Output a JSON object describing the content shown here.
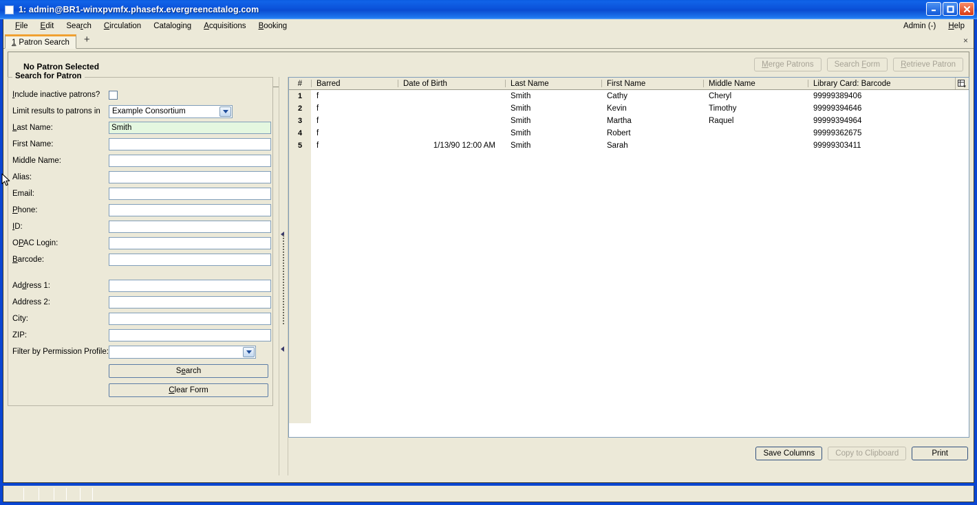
{
  "window": {
    "title": "1: admin@BR1-winxpvmfx.phasefx.evergreencatalog.com",
    "minimize_label": "Minimize",
    "maximize_label": "Maximize",
    "close_label": "Close"
  },
  "menubar": {
    "items": [
      {
        "label": "File",
        "accel_index": 0
      },
      {
        "label": "Edit",
        "accel_index": 0
      },
      {
        "label": "Search",
        "accel_index": 3
      },
      {
        "label": "Circulation",
        "accel_index": 0
      },
      {
        "label": "Cataloging",
        "accel_index": 8
      },
      {
        "label": "Acquisitions",
        "accel_index": 0
      },
      {
        "label": "Booking",
        "accel_index": 0
      }
    ],
    "right": [
      {
        "label": "Admin (-)",
        "accel_index": -1
      },
      {
        "label": "Help",
        "accel_index": 0
      }
    ]
  },
  "tabs": {
    "items": [
      {
        "number": "1",
        "label": "Patron Search"
      }
    ],
    "add_label": "+",
    "close_label": "×"
  },
  "patron_header": {
    "status_label": "No Patron Selected",
    "buttons": [
      {
        "label": "Merge Patrons",
        "accel_index": 0,
        "disabled": true
      },
      {
        "label": "Search Form",
        "accel_index": 7,
        "disabled": true
      },
      {
        "label": "Retrieve Patron",
        "accel_index": 0,
        "disabled": true
      }
    ]
  },
  "search_form": {
    "legend": "Search for Patron",
    "include_inactive": {
      "label": "Include inactive patrons?",
      "accel_index": 0,
      "checked": false
    },
    "limit_results": {
      "label": "Limit results to patrons in",
      "accel_index": -1,
      "value": "Example Consortium",
      "options": [
        "Example Consortium"
      ]
    },
    "fields": [
      {
        "label": "Last Name:",
        "accel_index": 0,
        "value": "Smith",
        "placeholder": "",
        "focused": true
      },
      {
        "label": "First Name:",
        "accel_index": -1,
        "value": "",
        "placeholder": "",
        "focused": false
      },
      {
        "label": "Middle Name:",
        "accel_index": -1,
        "value": "",
        "placeholder": "",
        "focused": false
      },
      {
        "label": "Alias:",
        "accel_index": -1,
        "value": "",
        "placeholder": "",
        "focused": false
      },
      {
        "label": "Email:",
        "accel_index": -1,
        "value": "",
        "placeholder": "",
        "focused": false
      },
      {
        "label": "Phone:",
        "accel_index": 0,
        "value": "",
        "placeholder": "",
        "focused": false
      },
      {
        "label": "ID:",
        "accel_index": 0,
        "value": "",
        "placeholder": "",
        "focused": false
      },
      {
        "label": "OPAC Login:",
        "accel_index": 1,
        "value": "",
        "placeholder": "",
        "focused": false
      },
      {
        "label": "Barcode:",
        "accel_index": 0,
        "value": "",
        "placeholder": "",
        "focused": false
      }
    ],
    "address_fields": [
      {
        "label": "Address 1:",
        "accel_index": 2,
        "value": "",
        "placeholder": "",
        "focused": false
      },
      {
        "label": "Address 2:",
        "accel_index": -1,
        "value": "",
        "placeholder": "",
        "focused": false
      },
      {
        "label": "City:",
        "accel_index": -1,
        "value": "",
        "placeholder": "",
        "focused": false
      },
      {
        "label": "ZIP:",
        "accel_index": -1,
        "value": "",
        "placeholder": "",
        "focused": false
      }
    ],
    "permission_profile": {
      "label": "Filter by Permission Profile:",
      "accel_index": -1,
      "value": "",
      "options": []
    },
    "search_button": {
      "label": "Search",
      "accel_index": 3
    },
    "clear_button": {
      "label": "Clear Form",
      "accel_index": 0
    }
  },
  "results": {
    "columns": [
      {
        "key": "num",
        "label": "#"
      },
      {
        "key": "barred",
        "label": "Barred"
      },
      {
        "key": "dob",
        "label": "Date of Birth"
      },
      {
        "key": "last",
        "label": "Last Name"
      },
      {
        "key": "first",
        "label": "First Name"
      },
      {
        "key": "middle",
        "label": "Middle Name"
      },
      {
        "key": "barcode",
        "label": "Library Card: Barcode"
      }
    ],
    "column_picker_icon": "column-picker-icon",
    "rows": [
      {
        "num": "1",
        "barred": "f",
        "dob": "",
        "last": "Smith",
        "first": "Cathy",
        "middle": "Cheryl",
        "barcode": "99999389406"
      },
      {
        "num": "2",
        "barred": "f",
        "dob": "",
        "last": "Smith",
        "first": "Kevin",
        "middle": "Timothy",
        "barcode": "99999394646"
      },
      {
        "num": "3",
        "barred": "f",
        "dob": "",
        "last": "Smith",
        "first": "Martha",
        "middle": "Raquel",
        "barcode": "99999394964"
      },
      {
        "num": "4",
        "barred": "f",
        "dob": "",
        "last": "Smith",
        "first": "Robert",
        "middle": "",
        "barcode": "99999362675"
      },
      {
        "num": "5",
        "barred": "f",
        "dob": "1/13/90 12:00 AM",
        "last": "Smith",
        "first": "Sarah",
        "middle": "",
        "barcode": "99999303411"
      }
    ],
    "buttons": [
      {
        "label": "Save Columns",
        "disabled": false
      },
      {
        "label": "Copy to Clipboard",
        "disabled": true
      },
      {
        "label": "Print",
        "disabled": false
      }
    ]
  },
  "statusbar": {
    "segments": [
      "",
      "",
      "",
      "",
      "",
      "",
      ""
    ]
  },
  "colors": {
    "titlebar_blue": "#0a51d8",
    "face": "#ece9d8",
    "focus_field": "#e4f7e0",
    "tab_accent": "#f0a030",
    "field_border": "#7f9db9"
  }
}
